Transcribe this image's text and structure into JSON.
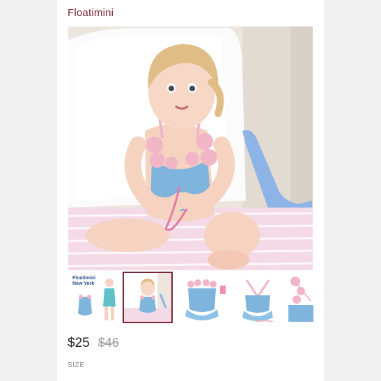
{
  "brand": "Floatimini",
  "gallery": {
    "thumb_1_caption_line1": "Floatimini",
    "thumb_1_caption_line2": "New York",
    "selected_index": 1
  },
  "price": {
    "current": "$25",
    "original": "$46"
  },
  "size_label": "SIZE",
  "colors": {
    "brand": "#7a2535",
    "swimsuit_blue": "#7fb4dc",
    "ruffle_pink": "#f0b6c8"
  }
}
